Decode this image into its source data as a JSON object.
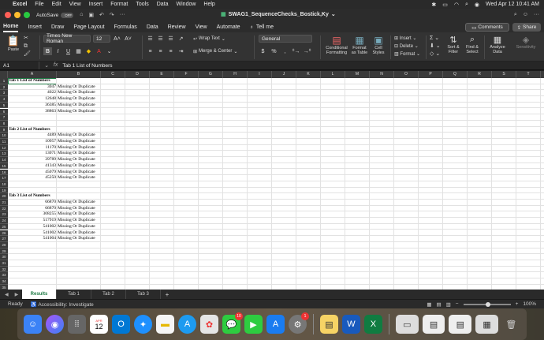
{
  "menubar": {
    "app": "Excel",
    "items": [
      "File",
      "Edit",
      "View",
      "Insert",
      "Format",
      "Tools",
      "Data",
      "Window",
      "Help"
    ],
    "datetime": "Wed Apr 12  10:41 AM"
  },
  "titlebar": {
    "autosave_label": "AutoSave",
    "autosave_state": "OFF",
    "document_title": "SWAG1_SequenceChecks_Bostick,Ky"
  },
  "ribbon_tabs": [
    "Home",
    "Insert",
    "Draw",
    "Page Layout",
    "Formulas",
    "Data",
    "Review",
    "View",
    "Automate"
  ],
  "tell_me": "Tell me",
  "comments_label": "Comments",
  "share_label": "Share",
  "ribbon": {
    "paste": "Paste",
    "font_name": "Times New Roman",
    "font_size": "12",
    "wrap_text": "Wrap Text",
    "merge_center": "Merge & Center",
    "number_format": "General",
    "conditional_formatting": "Conditional Formatting",
    "format_as_table": "Format as Table",
    "cell_styles": "Cell Styles",
    "insert": "Insert",
    "delete": "Delete",
    "format": "Format",
    "sort_filter": "Sort & Filter",
    "find_select": "Find & Select",
    "analyze_data": "Analyze Data",
    "sensitivity": "Sensitivity"
  },
  "formula_bar": {
    "name_box": "A1",
    "content": "Tab 1 List of Numbers"
  },
  "columns": [
    "A",
    "B",
    "C",
    "D",
    "E",
    "F",
    "G",
    "H",
    "I",
    "J",
    "K",
    "L",
    "M",
    "N",
    "O",
    "P",
    "Q",
    "R",
    "S",
    "T"
  ],
  "rows": [
    {
      "n": "1",
      "a": "Tab 1 List of Numbers",
      "b": "",
      "bold": true
    },
    {
      "n": "2",
      "a": "3047",
      "b": "Missing Or Duplicate"
    },
    {
      "n": "3",
      "a": "4022",
      "b": "Missing Or Duplicate"
    },
    {
      "n": "4",
      "a": "12648",
      "b": "Missing Or Duplicate"
    },
    {
      "n": "5",
      "a": "36385",
      "b": "Missing Or Duplicate"
    },
    {
      "n": "6",
      "a": "38863",
      "b": "Missing Or Duplicate"
    },
    {
      "n": "7",
      "a": "",
      "b": ""
    },
    {
      "n": "8",
      "a": "",
      "b": ""
    },
    {
      "n": "9",
      "a": "Tab 2 List of Numbers",
      "b": "",
      "bold": true
    },
    {
      "n": "10",
      "a": "4489",
      "b": "Missing Or Duplicate"
    },
    {
      "n": "11",
      "a": "10957",
      "b": "Missing Or Duplicate"
    },
    {
      "n": "12",
      "a": "11170",
      "b": "Missing Or Duplicate"
    },
    {
      "n": "13",
      "a": "13071",
      "b": "Missing Or Duplicate"
    },
    {
      "n": "14",
      "a": "39789",
      "b": "Missing Or Duplicate"
    },
    {
      "n": "15",
      "a": "41343",
      "b": "Missing Or Duplicate"
    },
    {
      "n": "16",
      "a": "45079",
      "b": "Missing Or Duplicate"
    },
    {
      "n": "17",
      "a": "45250",
      "b": "Missing Or Duplicate"
    },
    {
      "n": "18",
      "a": "",
      "b": ""
    },
    {
      "n": "19",
      "a": "",
      "b": ""
    },
    {
      "n": "20",
      "a": "Tab 3 List of Numbers",
      "b": "",
      "bold": true
    },
    {
      "n": "21",
      "a": "66870",
      "b": "Missing Or Duplicate"
    },
    {
      "n": "22",
      "a": "66870",
      "b": "Missing Or Duplicate"
    },
    {
      "n": "23",
      "a": "308255",
      "b": "Missing Or Duplicate"
    },
    {
      "n": "24",
      "a": "517919",
      "b": "Missing Or Duplicate"
    },
    {
      "n": "25",
      "a": "541002",
      "b": "Missing Or Duplicate"
    },
    {
      "n": "26",
      "a": "541002",
      "b": "Missing Or Duplicate"
    },
    {
      "n": "27",
      "a": "541004",
      "b": "Missing Or Duplicate"
    },
    {
      "n": "28",
      "a": "",
      "b": ""
    },
    {
      "n": "29",
      "a": "",
      "b": ""
    },
    {
      "n": "30",
      "a": "",
      "b": ""
    },
    {
      "n": "31",
      "a": "",
      "b": ""
    },
    {
      "n": "32",
      "a": "",
      "b": ""
    },
    {
      "n": "33",
      "a": "",
      "b": ""
    },
    {
      "n": "34",
      "a": "",
      "b": ""
    },
    {
      "n": "35",
      "a": "",
      "b": ""
    }
  ],
  "sheet_tabs": [
    "Results",
    "Tab 1",
    "Tab 2",
    "Tab 3"
  ],
  "status": {
    "ready": "Ready",
    "accessibility": "Accessibility: Investigate",
    "zoom": "100%"
  },
  "dock": {
    "calendar_month": "APR",
    "calendar_day": "12",
    "messages_badge": "10",
    "settings_badge": "1"
  },
  "colors": {
    "excel_green": "#1f7b45",
    "ribbon_bg": "#333333"
  }
}
